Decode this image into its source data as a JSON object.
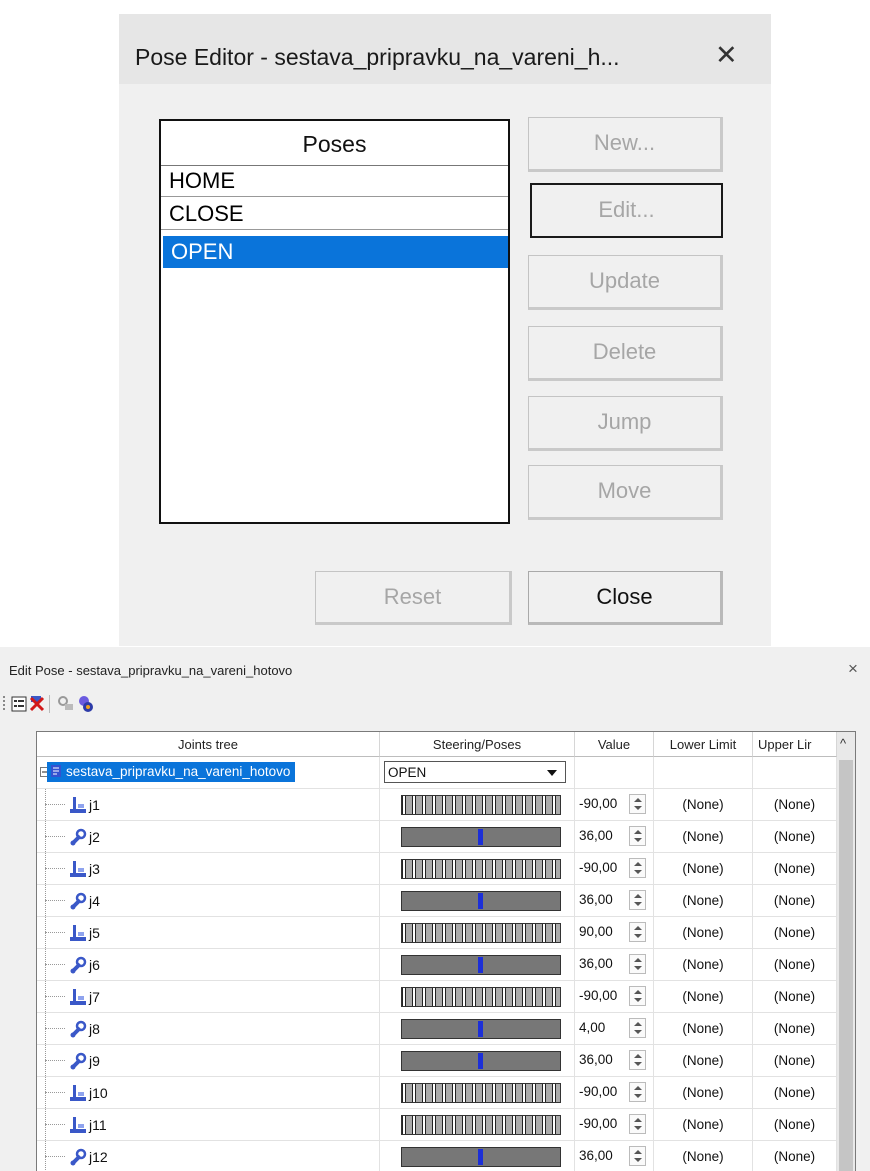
{
  "pose_editor": {
    "title": "Pose Editor - sestava_pripravku_na_vareni_h...",
    "close_glyph": "✕",
    "poses_header": "Poses",
    "poses": [
      "HOME",
      "CLOSE",
      "OPEN"
    ],
    "selected_pose": "OPEN",
    "buttons": {
      "new": "New...",
      "edit": "Edit...",
      "update": "Update",
      "delete": "Delete",
      "jump": "Jump",
      "move": "Move",
      "reset": "Reset",
      "close": "Close"
    }
  },
  "edit_pose": {
    "title": "Edit Pose - sestava_pripravku_na_vareni_hotovo",
    "close_glyph": "×",
    "columns": {
      "joints_tree": "Joints tree",
      "steering": "Steering/Poses",
      "value": "Value",
      "lower": "Lower Limit",
      "upper": "Upper Lir"
    },
    "scroll_up_glyph": "^",
    "root": {
      "name": "sestava_pripravku_na_vareni_hotovo",
      "pose": "OPEN"
    },
    "joints": [
      {
        "name": "j1",
        "kind": "linear",
        "value": "-90,00",
        "slider_fraction": 0.0,
        "lower": "(None)",
        "upper": "(None)"
      },
      {
        "name": "j2",
        "kind": "rotary",
        "value": "36,00",
        "slider_fraction": 0.5,
        "lower": "(None)",
        "upper": "(None)"
      },
      {
        "name": "j3",
        "kind": "linear",
        "value": "-90,00",
        "slider_fraction": 0.0,
        "lower": "(None)",
        "upper": "(None)"
      },
      {
        "name": "j4",
        "kind": "rotary",
        "value": "36,00",
        "slider_fraction": 0.5,
        "lower": "(None)",
        "upper": "(None)"
      },
      {
        "name": "j5",
        "kind": "linear",
        "value": "90,00",
        "slider_fraction": 0.0,
        "lower": "(None)",
        "upper": "(None)"
      },
      {
        "name": "j6",
        "kind": "rotary",
        "value": "36,00",
        "slider_fraction": 0.5,
        "lower": "(None)",
        "upper": "(None)"
      },
      {
        "name": "j7",
        "kind": "linear",
        "value": "-90,00",
        "slider_fraction": 0.0,
        "lower": "(None)",
        "upper": "(None)"
      },
      {
        "name": "j8",
        "kind": "rotary",
        "value": "4,00",
        "slider_fraction": 0.5,
        "lower": "(None)",
        "upper": "(None)"
      },
      {
        "name": "j9",
        "kind": "rotary",
        "value": "36,00",
        "slider_fraction": 0.5,
        "lower": "(None)",
        "upper": "(None)"
      },
      {
        "name": "j10",
        "kind": "linear",
        "value": "-90,00",
        "slider_fraction": 0.0,
        "lower": "(None)",
        "upper": "(None)"
      },
      {
        "name": "j11",
        "kind": "linear",
        "value": "-90,00",
        "slider_fraction": 0.0,
        "lower": "(None)",
        "upper": "(None)"
      },
      {
        "name": "j12",
        "kind": "rotary",
        "value": "36,00",
        "slider_fraction": 0.5,
        "lower": "(None)",
        "upper": "(None)"
      }
    ],
    "colors": {
      "selection": "#0a74da",
      "slider_knob": "#1c2fd8"
    }
  }
}
